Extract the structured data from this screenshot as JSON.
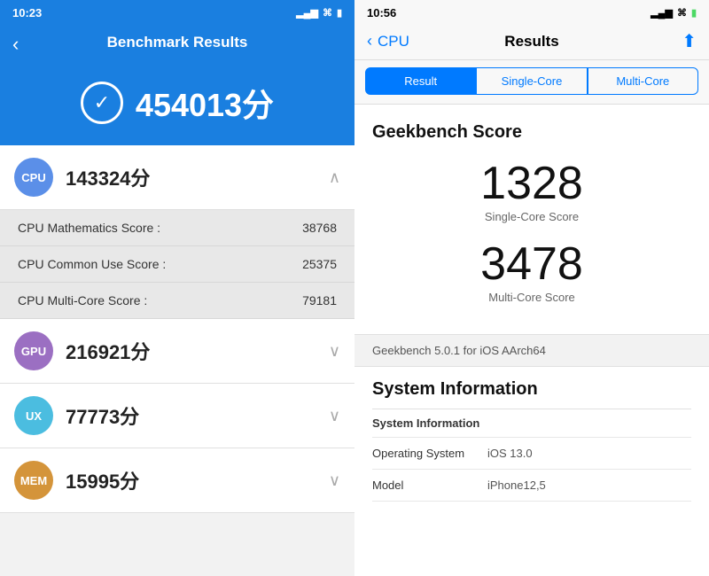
{
  "left": {
    "status_time": "10:23",
    "header_title": "Benchmark Results",
    "back_arrow": "‹",
    "total_score": "454013分",
    "categories": [
      {
        "id": "cpu",
        "label": "CPU",
        "score": "143324分",
        "badge_class": "badge-cpu",
        "expanded": true,
        "chevron": "∧",
        "sub_items": [
          {
            "label": "CPU Mathematics Score :",
            "value": "38768"
          },
          {
            "label": "CPU Common Use Score :",
            "value": "25375"
          },
          {
            "label": "CPU Multi-Core Score :",
            "value": "79181"
          }
        ]
      },
      {
        "id": "gpu",
        "label": "GPU",
        "score": "216921分",
        "badge_class": "badge-gpu",
        "expanded": false,
        "chevron": "∨",
        "sub_items": []
      },
      {
        "id": "ux",
        "label": "UX",
        "score": "77773分",
        "badge_class": "badge-ux",
        "expanded": false,
        "chevron": "∨",
        "sub_items": []
      },
      {
        "id": "mem",
        "label": "MEM",
        "score": "15995分",
        "badge_class": "badge-mem",
        "expanded": false,
        "chevron": "∨",
        "sub_items": []
      }
    ]
  },
  "right": {
    "status_time": "10:56",
    "nav_back": "‹",
    "nav_cpu": "CPU",
    "nav_title": "Results",
    "nav_share": "⬆",
    "tabs": [
      {
        "label": "Result",
        "active": true
      },
      {
        "label": "Single-Core",
        "active": false
      },
      {
        "label": "Multi-Core",
        "active": false
      }
    ],
    "geekbench_title": "Geekbench Score",
    "single_core_score": "1328",
    "single_core_label": "Single-Core Score",
    "multi_core_score": "3478",
    "multi_core_label": "Multi-Core Score",
    "geekbench_note": "Geekbench 5.0.1 for iOS AArch64",
    "system_info_title": "System Information",
    "system_info_header": "System Information",
    "sys_rows": [
      {
        "key": "Operating System",
        "value": "iOS 13.0"
      },
      {
        "key": "Model",
        "value": "iPhone12,5"
      }
    ]
  }
}
